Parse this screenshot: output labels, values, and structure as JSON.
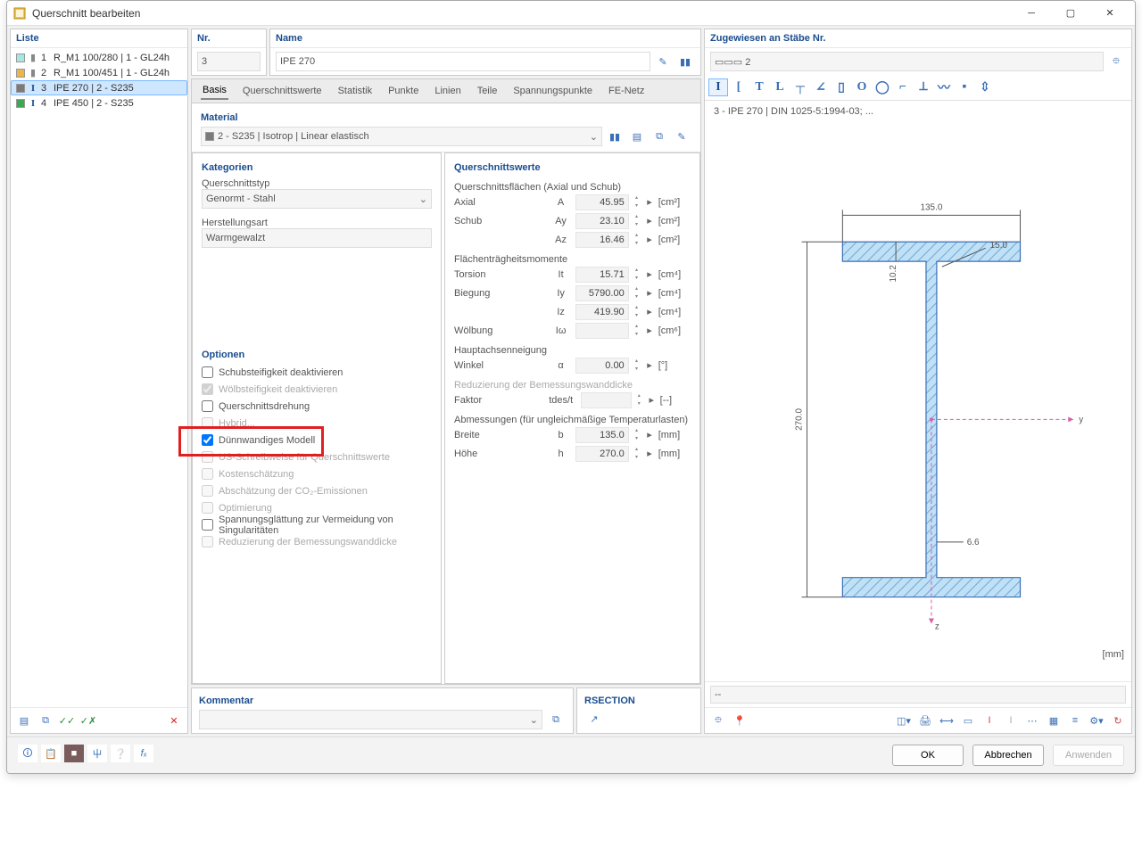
{
  "window": {
    "title": "Querschnitt bearbeiten"
  },
  "list": {
    "header": "Liste",
    "items": [
      {
        "num": "1",
        "label": "R_M1 100/280 | 1 - GL24h",
        "color": "#a7e7e2"
      },
      {
        "num": "2",
        "label": "R_M1 100/451 | 1 - GL24h",
        "color": "#e8b64a"
      },
      {
        "num": "3",
        "label": "IPE 270 | 2 - S235",
        "color": "#7a7a7a",
        "selected": true,
        "icon": "I"
      },
      {
        "num": "4",
        "label": "IPE 450 | 2 - S235",
        "color": "#3da84e",
        "icon": "I"
      }
    ]
  },
  "header_fields": {
    "nr_label": "Nr.",
    "nr_value": "3",
    "name_label": "Name",
    "name_value": "IPE 270",
    "assigned_label": "Zugewiesen an Stäbe Nr.",
    "assigned_value": "▭▭▭ 2"
  },
  "tabs": [
    "Basis",
    "Querschnittswerte",
    "Statistik",
    "Punkte",
    "Linien",
    "Teile",
    "Spannungspunkte",
    "FE-Netz"
  ],
  "material": {
    "heading": "Material",
    "value": "2 - S235 | Isotrop | Linear elastisch"
  },
  "categories": {
    "heading": "Kategorien",
    "type_label": "Querschnittstyp",
    "type_value": "Genormt - Stahl",
    "manu_label": "Herstellungsart",
    "manu_value": "Warmgewalzt"
  },
  "options": {
    "heading": "Optionen",
    "items": [
      {
        "label": "Schubsteifigkeit deaktivieren",
        "checked": false,
        "disabled": false
      },
      {
        "label": "Wölbsteifigkeit deaktivieren",
        "checked": true,
        "disabled": true
      },
      {
        "label": "Querschnittsdrehung",
        "checked": false,
        "disabled": false
      },
      {
        "label": "Hybrid...",
        "checked": false,
        "disabled": true
      },
      {
        "label": "Dünnwandiges Modell",
        "checked": true,
        "disabled": false
      },
      {
        "label": "US-Schreibweise für Querschnittswerte",
        "checked": false,
        "disabled": true
      },
      {
        "label": "Kostenschätzung",
        "checked": false,
        "disabled": true
      },
      {
        "label": "Abschätzung der CO₂-Emissionen",
        "checked": false,
        "disabled": true
      },
      {
        "label": "Optimierung",
        "checked": false,
        "disabled": true
      },
      {
        "label": "Spannungsglättung zur Vermeidung von Singularitäten",
        "checked": false,
        "disabled": false
      },
      {
        "label": "Reduzierung der Bemessungswanddicke",
        "checked": false,
        "disabled": true
      }
    ]
  },
  "values": {
    "heading": "Querschnittswerte",
    "areas_heading": "Querschnittsflächen (Axial und Schub)",
    "area_rows": [
      {
        "lbl": "Axial",
        "sym": "A",
        "val": "45.95",
        "unit": "[cm²]"
      },
      {
        "lbl": "Schub",
        "sym": "Ay",
        "val": "23.10",
        "unit": "[cm²]"
      },
      {
        "lbl": "",
        "sym": "Az",
        "val": "16.46",
        "unit": "[cm²]"
      }
    ],
    "moi_heading": "Flächenträgheitsmomente",
    "moi_rows": [
      {
        "lbl": "Torsion",
        "sym": "It",
        "val": "15.71",
        "unit": "[cm⁴]"
      },
      {
        "lbl": "Biegung",
        "sym": "Iy",
        "val": "5790.00",
        "unit": "[cm⁴]"
      },
      {
        "lbl": "",
        "sym": "Iz",
        "val": "419.90",
        "unit": "[cm⁴]"
      },
      {
        "lbl": "Wölbung",
        "sym": "Iω",
        "val": "",
        "unit": "[cm⁶]",
        "disabled": true
      }
    ],
    "incl_heading": "Hauptachsenneigung",
    "incl_rows": [
      {
        "lbl": "Winkel",
        "sym": "α",
        "val": "0.00",
        "unit": "[°]"
      }
    ],
    "reduct_heading": "Reduzierung der Bemessungswanddicke",
    "reduct_rows": [
      {
        "lbl": "Faktor",
        "sym": "tdes/t",
        "val": "",
        "unit": "[--]",
        "disabled": true
      }
    ],
    "dims_heading": "Abmessungen (für ungleichmäßige Temperaturlasten)",
    "dims_rows": [
      {
        "lbl": "Breite",
        "sym": "b",
        "val": "135.0",
        "unit": "[mm]"
      },
      {
        "lbl": "Höhe",
        "sym": "h",
        "val": "270.0",
        "unit": "[mm]"
      }
    ]
  },
  "kommentar": {
    "heading": "Kommentar",
    "rsection": "RSECTION"
  },
  "diagram": {
    "caption": "3 - IPE 270 | DIN 1025-5:1994-03; ...",
    "width_label": "135.0",
    "height_label": "270.0",
    "tf_label": "10.2",
    "tw_label": "6.6",
    "r_label": "15.0",
    "unit": "[mm]"
  },
  "buttons": {
    "ok": "OK",
    "cancel": "Abbrechen",
    "apply": "Anwenden"
  }
}
